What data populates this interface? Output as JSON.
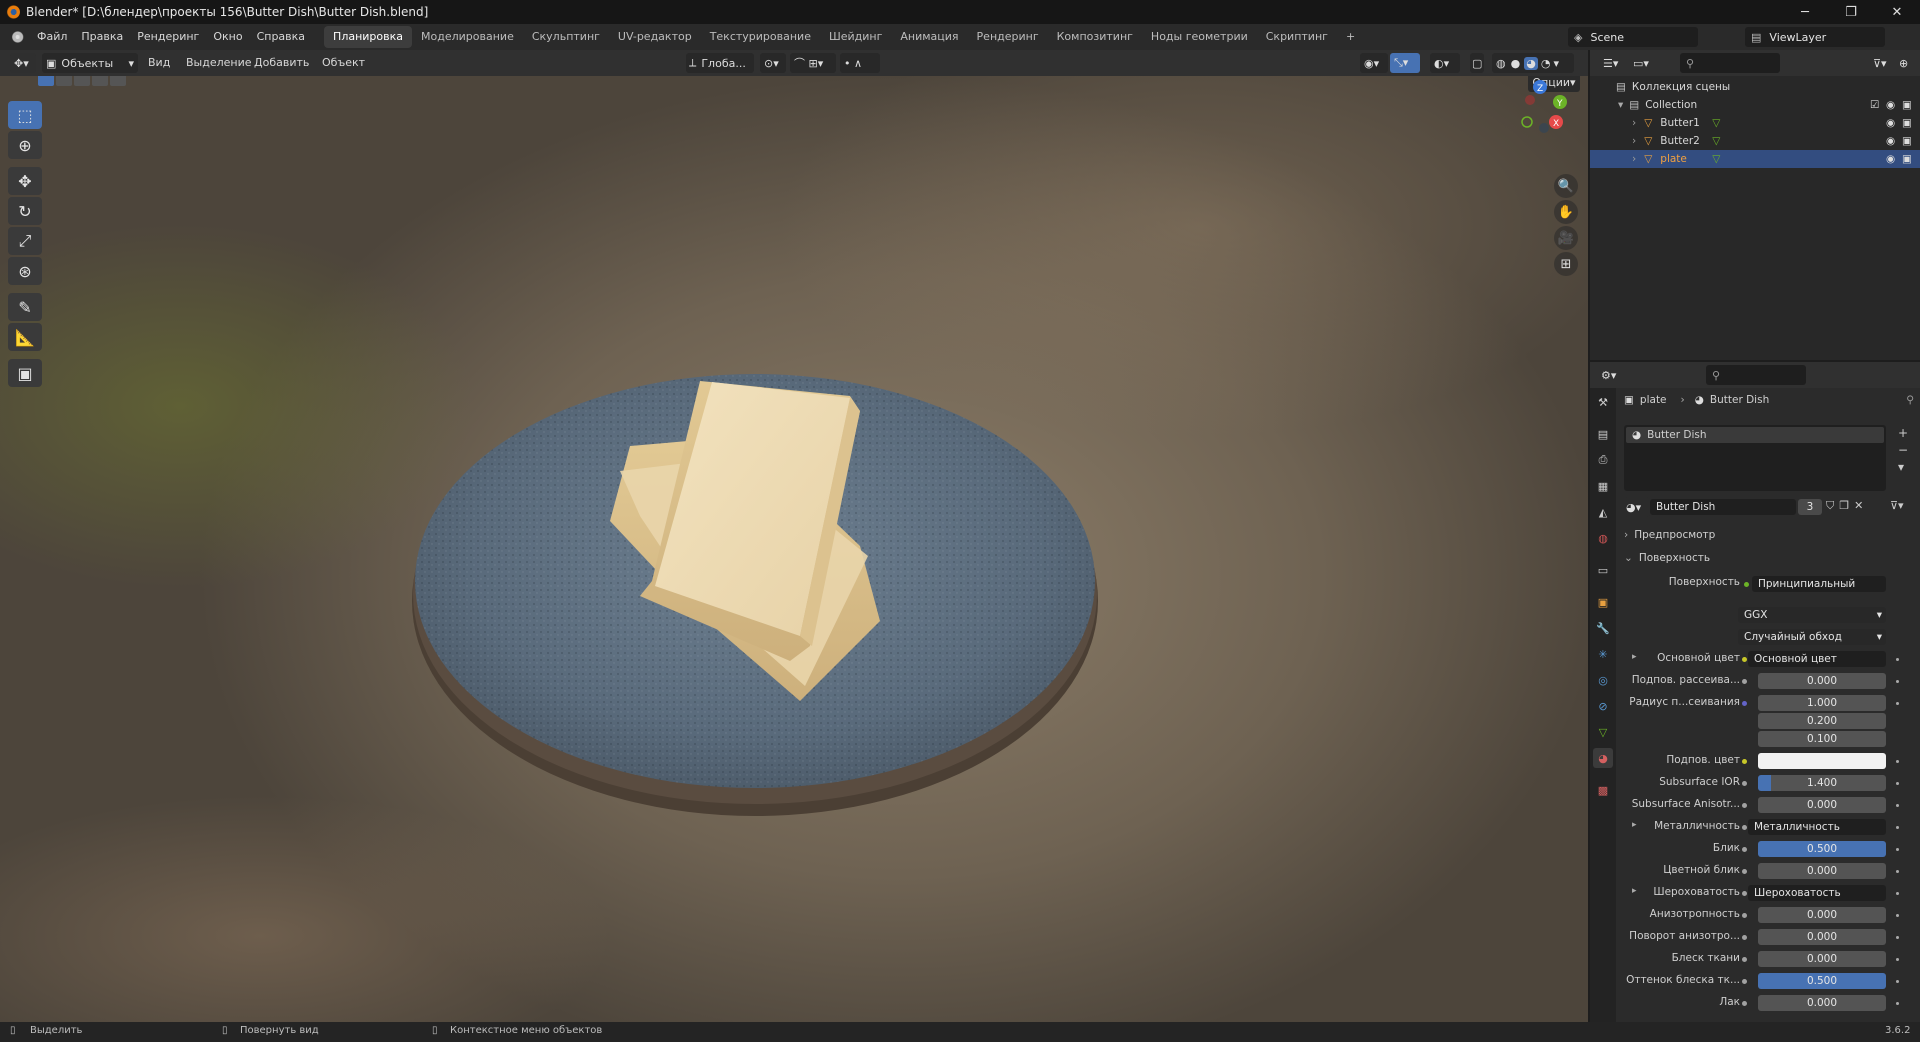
{
  "colors": {
    "accent": "#4772b3",
    "selection": "#334d80",
    "socket_yellow": "#c7c729",
    "socket_gray": "#a1a1a1",
    "socket_purple": "#6363c7",
    "axis_x": "#e64a4a",
    "axis_y": "#6cb327",
    "axis_z": "#3b78d8"
  },
  "titlebar": {
    "title": "Blender* [D:\\блендер\\проекты 156\\Butter Dish\\Butter Dish.blend]",
    "minimize": "─",
    "maximize": "❐",
    "close": "✕"
  },
  "menu": [
    "Файл",
    "Правка",
    "Рендеринг",
    "Окно",
    "Справка"
  ],
  "workspaces": [
    "Планировка",
    "Моделирование",
    "Скульптинг",
    "UV-редактор",
    "Текстурирование",
    "Шейдинг",
    "Анимация",
    "Рендеринг",
    "Композитинг",
    "Ноды геометрии",
    "Скриптинг",
    "+"
  ],
  "active_workspace": "Планировка",
  "scene": {
    "label": "Scene",
    "viewlayer": "ViewLayer"
  },
  "viewport_header": {
    "mode": "Объекты",
    "menus": [
      "Вид",
      "Выделение",
      "Добавить",
      "Объект"
    ],
    "orientation": "Глоба...",
    "options": "Опции"
  },
  "gizmo": {
    "x": "X",
    "y": "Y",
    "z": "Z"
  },
  "outliner": {
    "root": "Коллекция сцены",
    "collection": "Collection",
    "objects": [
      {
        "name": "Butter1",
        "selected": false
      },
      {
        "name": "Butter2",
        "selected": false
      },
      {
        "name": "plate",
        "selected": true
      }
    ]
  },
  "properties": {
    "breadcrumb": {
      "object": "plate",
      "material": "Butter Dish"
    },
    "slot": "Butter Dish",
    "material_name": "Butter Dish",
    "users": "3",
    "sections": {
      "preview": "Предпросмотр",
      "surface": "Поверхность"
    },
    "surface_shader_label": "Поверхность",
    "surface_shader": "Принципиальный BSDF",
    "distribution": "GGX",
    "subsurface_method": "Случайный обход",
    "rows": [
      {
        "label": "Основной цвет",
        "value": "Основной цвет",
        "kind": "link",
        "sock": "yellow"
      },
      {
        "label": "Подпов. рассеива...",
        "value": "0.000",
        "kind": "num",
        "sock": "gray"
      },
      {
        "label": "Радиус п...сеивания",
        "value": "1.000",
        "kind": "num",
        "sock": "purple"
      },
      {
        "label": "",
        "value": "0.200",
        "kind": "num",
        "sock": ""
      },
      {
        "label": "",
        "value": "0.100",
        "kind": "num",
        "sock": ""
      },
      {
        "label": "Подпов. цвет",
        "value": "",
        "kind": "color",
        "sock": "yellow"
      },
      {
        "label": "Subsurface IOR",
        "value": "1.400",
        "kind": "num",
        "sock": "gray"
      },
      {
        "label": "Subsurface Anisotr...",
        "value": "0.000",
        "kind": "num",
        "sock": "gray"
      },
      {
        "label": "Металличность",
        "value": "Металличность",
        "kind": "link",
        "sock": "gray"
      },
      {
        "label": "Блик",
        "value": "0.500",
        "kind": "blue",
        "sock": "gray"
      },
      {
        "label": "Цветной блик",
        "value": "0.000",
        "kind": "num",
        "sock": "gray"
      },
      {
        "label": "Шероховатость",
        "value": "Шероховатость",
        "kind": "link",
        "sock": "gray"
      },
      {
        "label": "Анизотропность",
        "value": "0.000",
        "kind": "num",
        "sock": "gray"
      },
      {
        "label": "Поворот анизотро...",
        "value": "0.000",
        "kind": "num",
        "sock": "gray"
      },
      {
        "label": "Блеск ткани",
        "value": "0.000",
        "kind": "num",
        "sock": "gray"
      },
      {
        "label": "Оттенок блеска тк...",
        "value": "0.500",
        "kind": "blue",
        "sock": "gray"
      },
      {
        "label": "Лак",
        "value": "0.000",
        "kind": "num",
        "sock": "gray"
      }
    ]
  },
  "statusbar": {
    "select": "Выделить",
    "rotate": "Повернуть вид",
    "context": "Контекстное меню объектов",
    "version": "3.6.2"
  }
}
